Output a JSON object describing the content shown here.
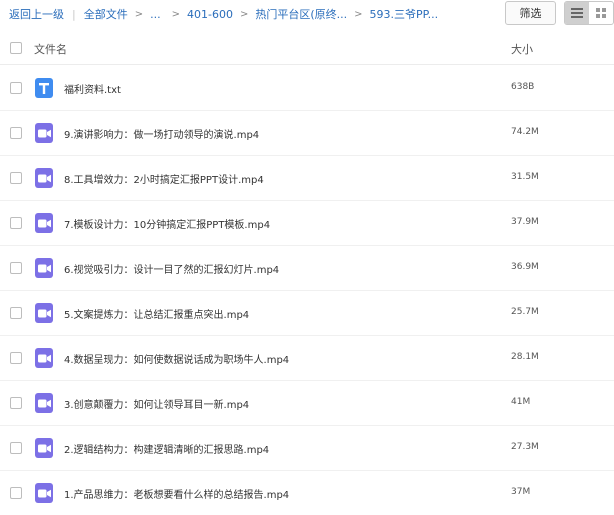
{
  "breadcrumb": {
    "back": "返回上一级",
    "all_files": "全部文件",
    "ellipsis": "...",
    "items": [
      "401-600",
      "热门平台区(原终...",
      "593.三爷PP..."
    ]
  },
  "toolbar": {
    "filter_label": "筛选",
    "view_modes": [
      "list-view-icon",
      "grid-view-icon"
    ],
    "active_view": "list"
  },
  "table": {
    "col_name": "文件名",
    "col_size": "大小",
    "rows": [
      {
        "name": "福利资料.txt",
        "size": "638B",
        "type": "txt"
      },
      {
        "name": "9.演讲影响力：做一场打动领导的演说.mp4",
        "size": "74.2M",
        "type": "video"
      },
      {
        "name": "8.工具增效力：2小时搞定汇报PPT设计.mp4",
        "size": "31.5M",
        "type": "video"
      },
      {
        "name": "7.模板设计力：10分钟搞定汇报PPT模板.mp4",
        "size": "37.9M",
        "type": "video"
      },
      {
        "name": "6.视觉吸引力：设计一目了然的汇报幻灯片.mp4",
        "size": "36.9M",
        "type": "video"
      },
      {
        "name": "5.文案提炼力：让总结汇报重点突出.mp4",
        "size": "25.7M",
        "type": "video"
      },
      {
        "name": "4.数据呈现力：如何使数据说话成为职场牛人.mp4",
        "size": "28.1M",
        "type": "video"
      },
      {
        "name": "3.创意颠覆力：如何让领导耳目一新.mp4",
        "size": "41M",
        "type": "video"
      },
      {
        "name": "2.逻辑结构力：构建逻辑清晰的汇报思路.mp4",
        "size": "27.3M",
        "type": "video"
      },
      {
        "name": "1.产品思维力：老板想要看什么样的总结报告.mp4",
        "size": "37M",
        "type": "video"
      }
    ]
  },
  "colors": {
    "link": "#2a6dbb",
    "txt_icon": "#3f8cf0",
    "video_icon": "#7c70e6"
  }
}
